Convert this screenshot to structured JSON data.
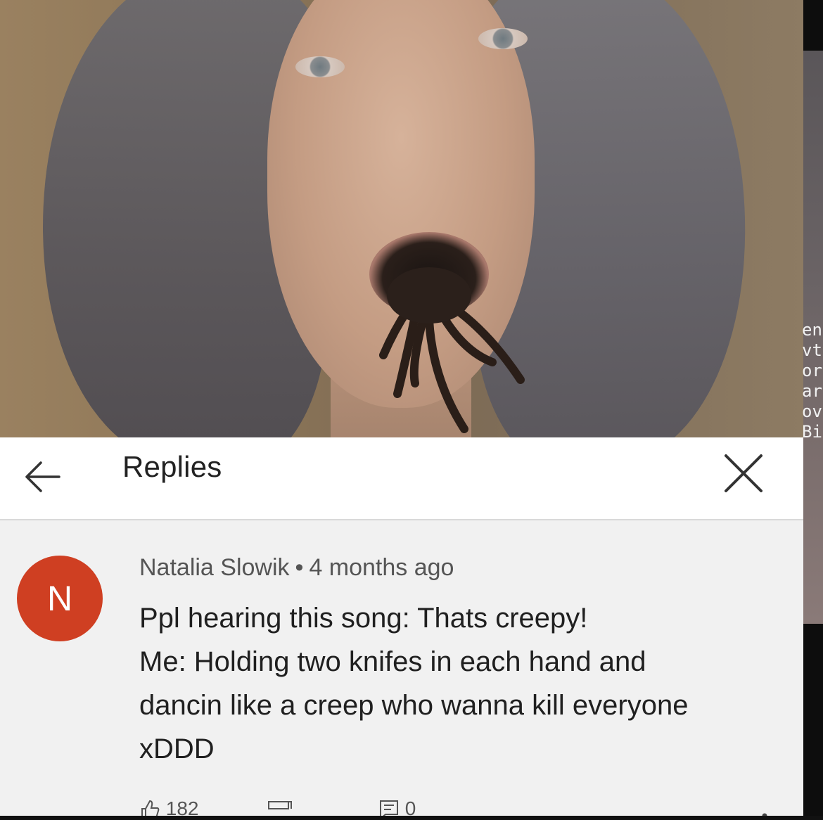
{
  "header": {
    "title": "Replies"
  },
  "comment": {
    "avatar_letter": "N",
    "author": "Natalia Slowik",
    "separator": "•",
    "time": "4 months ago",
    "lines": [
      "Ppl hearing this song: Thats creepy!",
      "Me: Holding two knifes in each hand and",
      "dancin like a creep who wanna kill everyone",
      "xDDD"
    ],
    "like_count": "182",
    "reply_count": "0"
  },
  "side_strip": {
    "text_lines": [
      "en",
      "vt",
      "or",
      "ar",
      "ov",
      "Bi"
    ]
  },
  "colors": {
    "avatar": "#cf3f22",
    "header_bg": "#ffffff",
    "comment_bg": "#f1f1f1"
  },
  "icons": {
    "back": "arrow-left-icon",
    "close": "close-icon",
    "like": "thumbs-up-icon",
    "dislike": "thumbs-down-icon",
    "reply": "reply-icon",
    "more": "more-vert-icon"
  }
}
